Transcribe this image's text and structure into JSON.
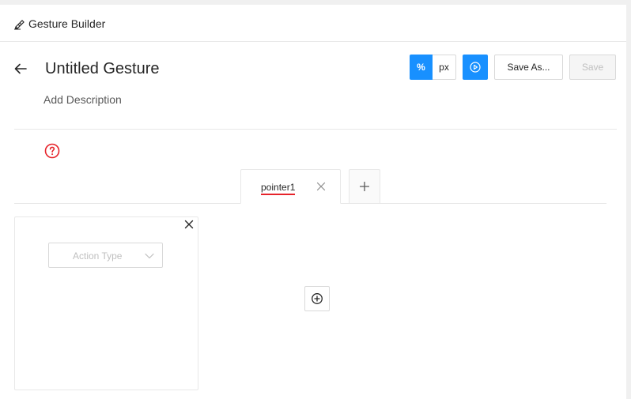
{
  "app": {
    "title": "Gesture Builder",
    "icon": "signature-pen-icon"
  },
  "header": {
    "back_icon": "arrow-left-icon",
    "title": "Untitled Gesture",
    "description": "Add Description"
  },
  "toolbar": {
    "unit_percent_label": "%",
    "unit_px_label": "px",
    "selected_unit": "%",
    "play_icon": "play-circle-icon",
    "save_as_label": "Save As...",
    "save_label": "Save",
    "save_disabled": true
  },
  "help": {
    "icon": "question-circle-icon",
    "color": "#e6232a"
  },
  "tabs": {
    "items": [
      {
        "label": "pointer1",
        "close_icon": "close-icon"
      }
    ],
    "add_icon": "plus-icon"
  },
  "action_card": {
    "close_icon": "close-icon",
    "select_placeholder": "Action Type",
    "select_arrow_icon": "chevron-down-icon"
  },
  "add_action": {
    "icon": "plus-circle-icon"
  },
  "colors": {
    "accent": "#1890ff",
    "tab_underline": "#e6232a",
    "border": "#d9d9d9",
    "disabled_text": "#bfbfbf"
  }
}
